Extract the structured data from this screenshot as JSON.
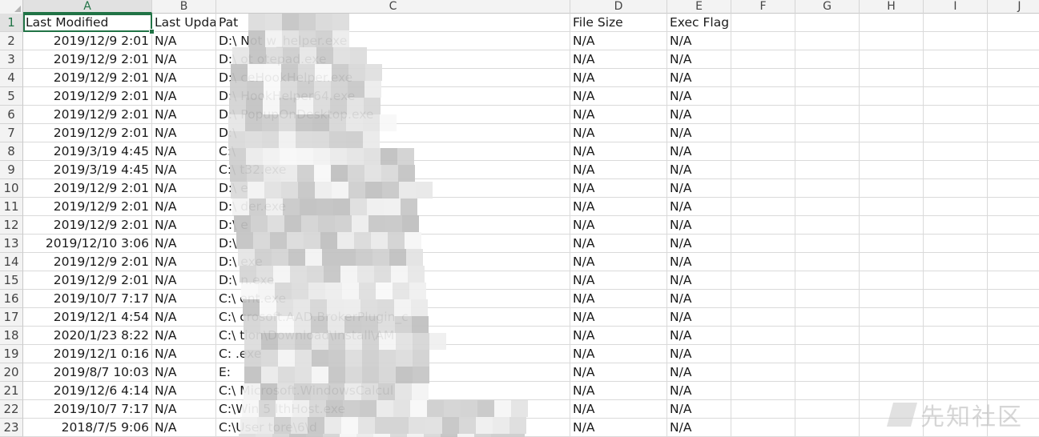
{
  "columns": [
    {
      "label": "A",
      "active": true
    },
    {
      "label": "B",
      "active": false
    },
    {
      "label": "C",
      "active": false
    },
    {
      "label": "D",
      "active": false
    },
    {
      "label": "E",
      "active": false
    },
    {
      "label": "F",
      "active": false
    },
    {
      "label": "G",
      "active": false
    },
    {
      "label": "H",
      "active": false
    },
    {
      "label": "I",
      "active": false
    },
    {
      "label": "J",
      "active": false
    }
  ],
  "header_row": {
    "row_number": "1",
    "a": "Last Modified",
    "b": "Last Upda",
    "c": "Pat",
    "d": "File Size",
    "e": "Exec Flag"
  },
  "rows": [
    {
      "n": "2",
      "a": "2019/12/9 2:01",
      "b": "N/A",
      "c": "D:\\           Not        w_helper.exe",
      "d": "N/A",
      "e": "N/A"
    },
    {
      "n": "3",
      "a": "2019/12/9 2:01",
      "b": "N/A",
      "c": "D:\\               ot       otepad.exe",
      "d": "N/A",
      "e": "N/A"
    },
    {
      "n": "4",
      "a": "2019/12/9 2:01",
      "b": "N/A",
      "c": "D:\\                          ceHookHelper.exe",
      "d": "N/A",
      "e": "N/A"
    },
    {
      "n": "5",
      "a": "2019/12/9 2:01",
      "b": "N/A",
      "c": "D:\\                            HookHelper64.exe",
      "d": "N/A",
      "e": "N/A"
    },
    {
      "n": "6",
      "a": "2019/12/9 2:01",
      "b": "N/A",
      "c": "D:\\                             PopupOnDesktop.exe",
      "d": "N/A",
      "e": "N/A"
    },
    {
      "n": "7",
      "a": "2019/12/9 2:01",
      "b": "N/A",
      "c": "D:\\",
      "d": "N/A",
      "e": "N/A"
    },
    {
      "n": "8",
      "a": "2019/3/19 4:45",
      "b": "N/A",
      "c": "C:\\",
      "d": "N/A",
      "e": "N/A"
    },
    {
      "n": "9",
      "a": "2019/3/19 4:45",
      "b": "N/A",
      "c": "C:\\                                        t32.exe",
      "d": "N/A",
      "e": "N/A"
    },
    {
      "n": "10",
      "a": "2019/12/9 2:01",
      "b": "N/A",
      "c": "D:\\                                           e",
      "d": "N/A",
      "e": "N/A"
    },
    {
      "n": "11",
      "a": "2019/12/9 2:01",
      "b": "N/A",
      "c": "D:\\                                     der.exe",
      "d": "N/A",
      "e": "N/A"
    },
    {
      "n": "12",
      "a": "2019/12/9 2:01",
      "b": "N/A",
      "c": "D:\\                                           e",
      "d": "N/A",
      "e": "N/A"
    },
    {
      "n": "13",
      "a": "2019/12/10 3:06",
      "b": "N/A",
      "c": "D:\\",
      "d": "N/A",
      "e": "N/A"
    },
    {
      "n": "14",
      "a": "2019/12/9 2:01",
      "b": "N/A",
      "c": "D:\\                                      exe",
      "d": "N/A",
      "e": "N/A"
    },
    {
      "n": "15",
      "a": "2019/12/9 2:01",
      "b": "N/A",
      "c": "D:\\                                      n.exe",
      "d": "N/A",
      "e": "N/A"
    },
    {
      "n": "16",
      "a": "2019/10/7 7:17",
      "b": "N/A",
      "c": "C:\\                                     ent.exe",
      "d": "N/A",
      "e": "N/A"
    },
    {
      "n": "17",
      "a": "2019/12/1 4:54",
      "b": "N/A",
      "c": "C:\\                              crosoft.AAD.BrokerPlugin_c",
      "d": "N/A",
      "e": "N/A"
    },
    {
      "n": "18",
      "a": "2020/1/23 8:22",
      "b": "N/A",
      "c": "C:\\                              tion\\Download\\Install\\AM",
      "d": "N/A",
      "e": "N/A"
    },
    {
      "n": "19",
      "a": "2019/12/1 0:16",
      "b": "N/A",
      "c": "C:                                          .exe",
      "d": "N/A",
      "e": "N/A"
    },
    {
      "n": "20",
      "a": "2019/8/7 10:03",
      "b": "N/A",
      "c": "E:",
      "d": "N/A",
      "e": "N/A"
    },
    {
      "n": "21",
      "a": "2019/12/6 4:14",
      "b": "N/A",
      "c": "C:\\                             Microsoft.WindowsCalcul",
      "d": "N/A",
      "e": "N/A"
    },
    {
      "n": "22",
      "a": "2019/10/7 7:17",
      "b": "N/A",
      "c": "C:\\Win             5                         lthHost.exe",
      "d": "N/A",
      "e": "N/A"
    },
    {
      "n": "23",
      "a": "2018/7/5 9:06",
      "b": "N/A",
      "c": "C:\\User                                      tore\\6\\d",
      "d": "N/A",
      "e": "N/A"
    }
  ],
  "watermark": {
    "text": "先知社区",
    "icon": "xianzhi-logo-icon"
  },
  "colors": {
    "accent": "#217346",
    "grid": "#dadada",
    "header_bg": "#f3f3f3"
  }
}
